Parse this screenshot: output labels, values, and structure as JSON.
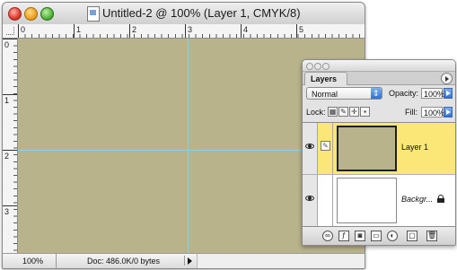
{
  "document_window": {
    "title": "Untitled-2 @ 100% (Layer 1, CMYK/8)",
    "ruler_numbers_h": [
      "0",
      "1",
      "2",
      "3",
      "4",
      "5"
    ],
    "ruler_numbers_v": [
      "0",
      "1",
      "2",
      "3"
    ],
    "canvas_color": "#b9b38b",
    "guide_color": "#7fd4ee",
    "status": {
      "zoom": "100%",
      "doc_info": "Doc: 486.0K/0 bytes"
    }
  },
  "layers_panel": {
    "tab_label": "Layers",
    "blend_mode": "Normal",
    "opacity_label": "Opacity:",
    "opacity_value": "100%",
    "lock_label": "Lock:",
    "fill_label": "Fill:",
    "fill_value": "100%",
    "layers": [
      {
        "name": "Layer 1",
        "selected": true,
        "thumb_color": "#b9b38b"
      },
      {
        "name": "Backgr...",
        "selected": false,
        "locked": true,
        "thumb_color": "#ffffff"
      }
    ],
    "selected_row_color": "#fbe678",
    "footer_icons": [
      "link-icon",
      "layer-style-icon",
      "mask-icon",
      "new-group-icon",
      "adjustment-layer-icon",
      "new-layer-icon",
      "trash-icon"
    ]
  }
}
